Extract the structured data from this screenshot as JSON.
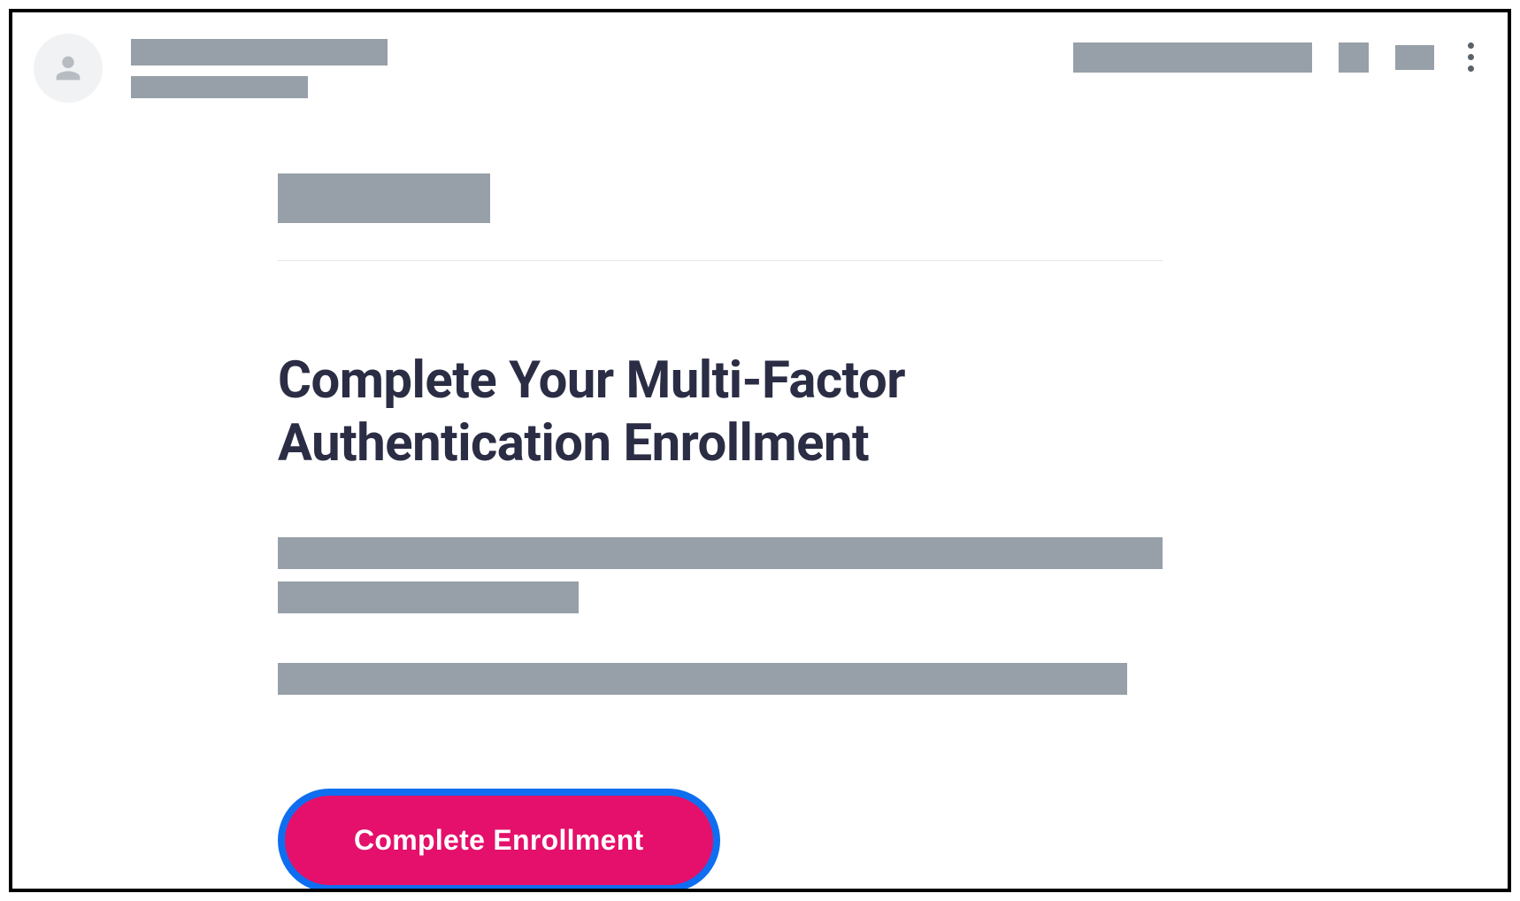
{
  "header": {
    "sender_name": "[redacted]",
    "sender_sub": "[redacted]",
    "action_long": "[redacted]",
    "action_small": "[redacted]",
    "action_med": "[redacted]",
    "kebab_label": "More options"
  },
  "body": {
    "brand": "[redacted]",
    "headline": "Complete Your Multi-Factor Authentication Enrollment",
    "para1_line1": "[redacted]",
    "para1_line2": "[redacted]",
    "para2_line1": "[redacted]",
    "cta_label": "Complete Enrollment"
  },
  "colors": {
    "redacted": "#97a0a8",
    "headline": "#2a2d44",
    "cta_bg": "#e4106b",
    "cta_border": "#0f6ef0"
  }
}
